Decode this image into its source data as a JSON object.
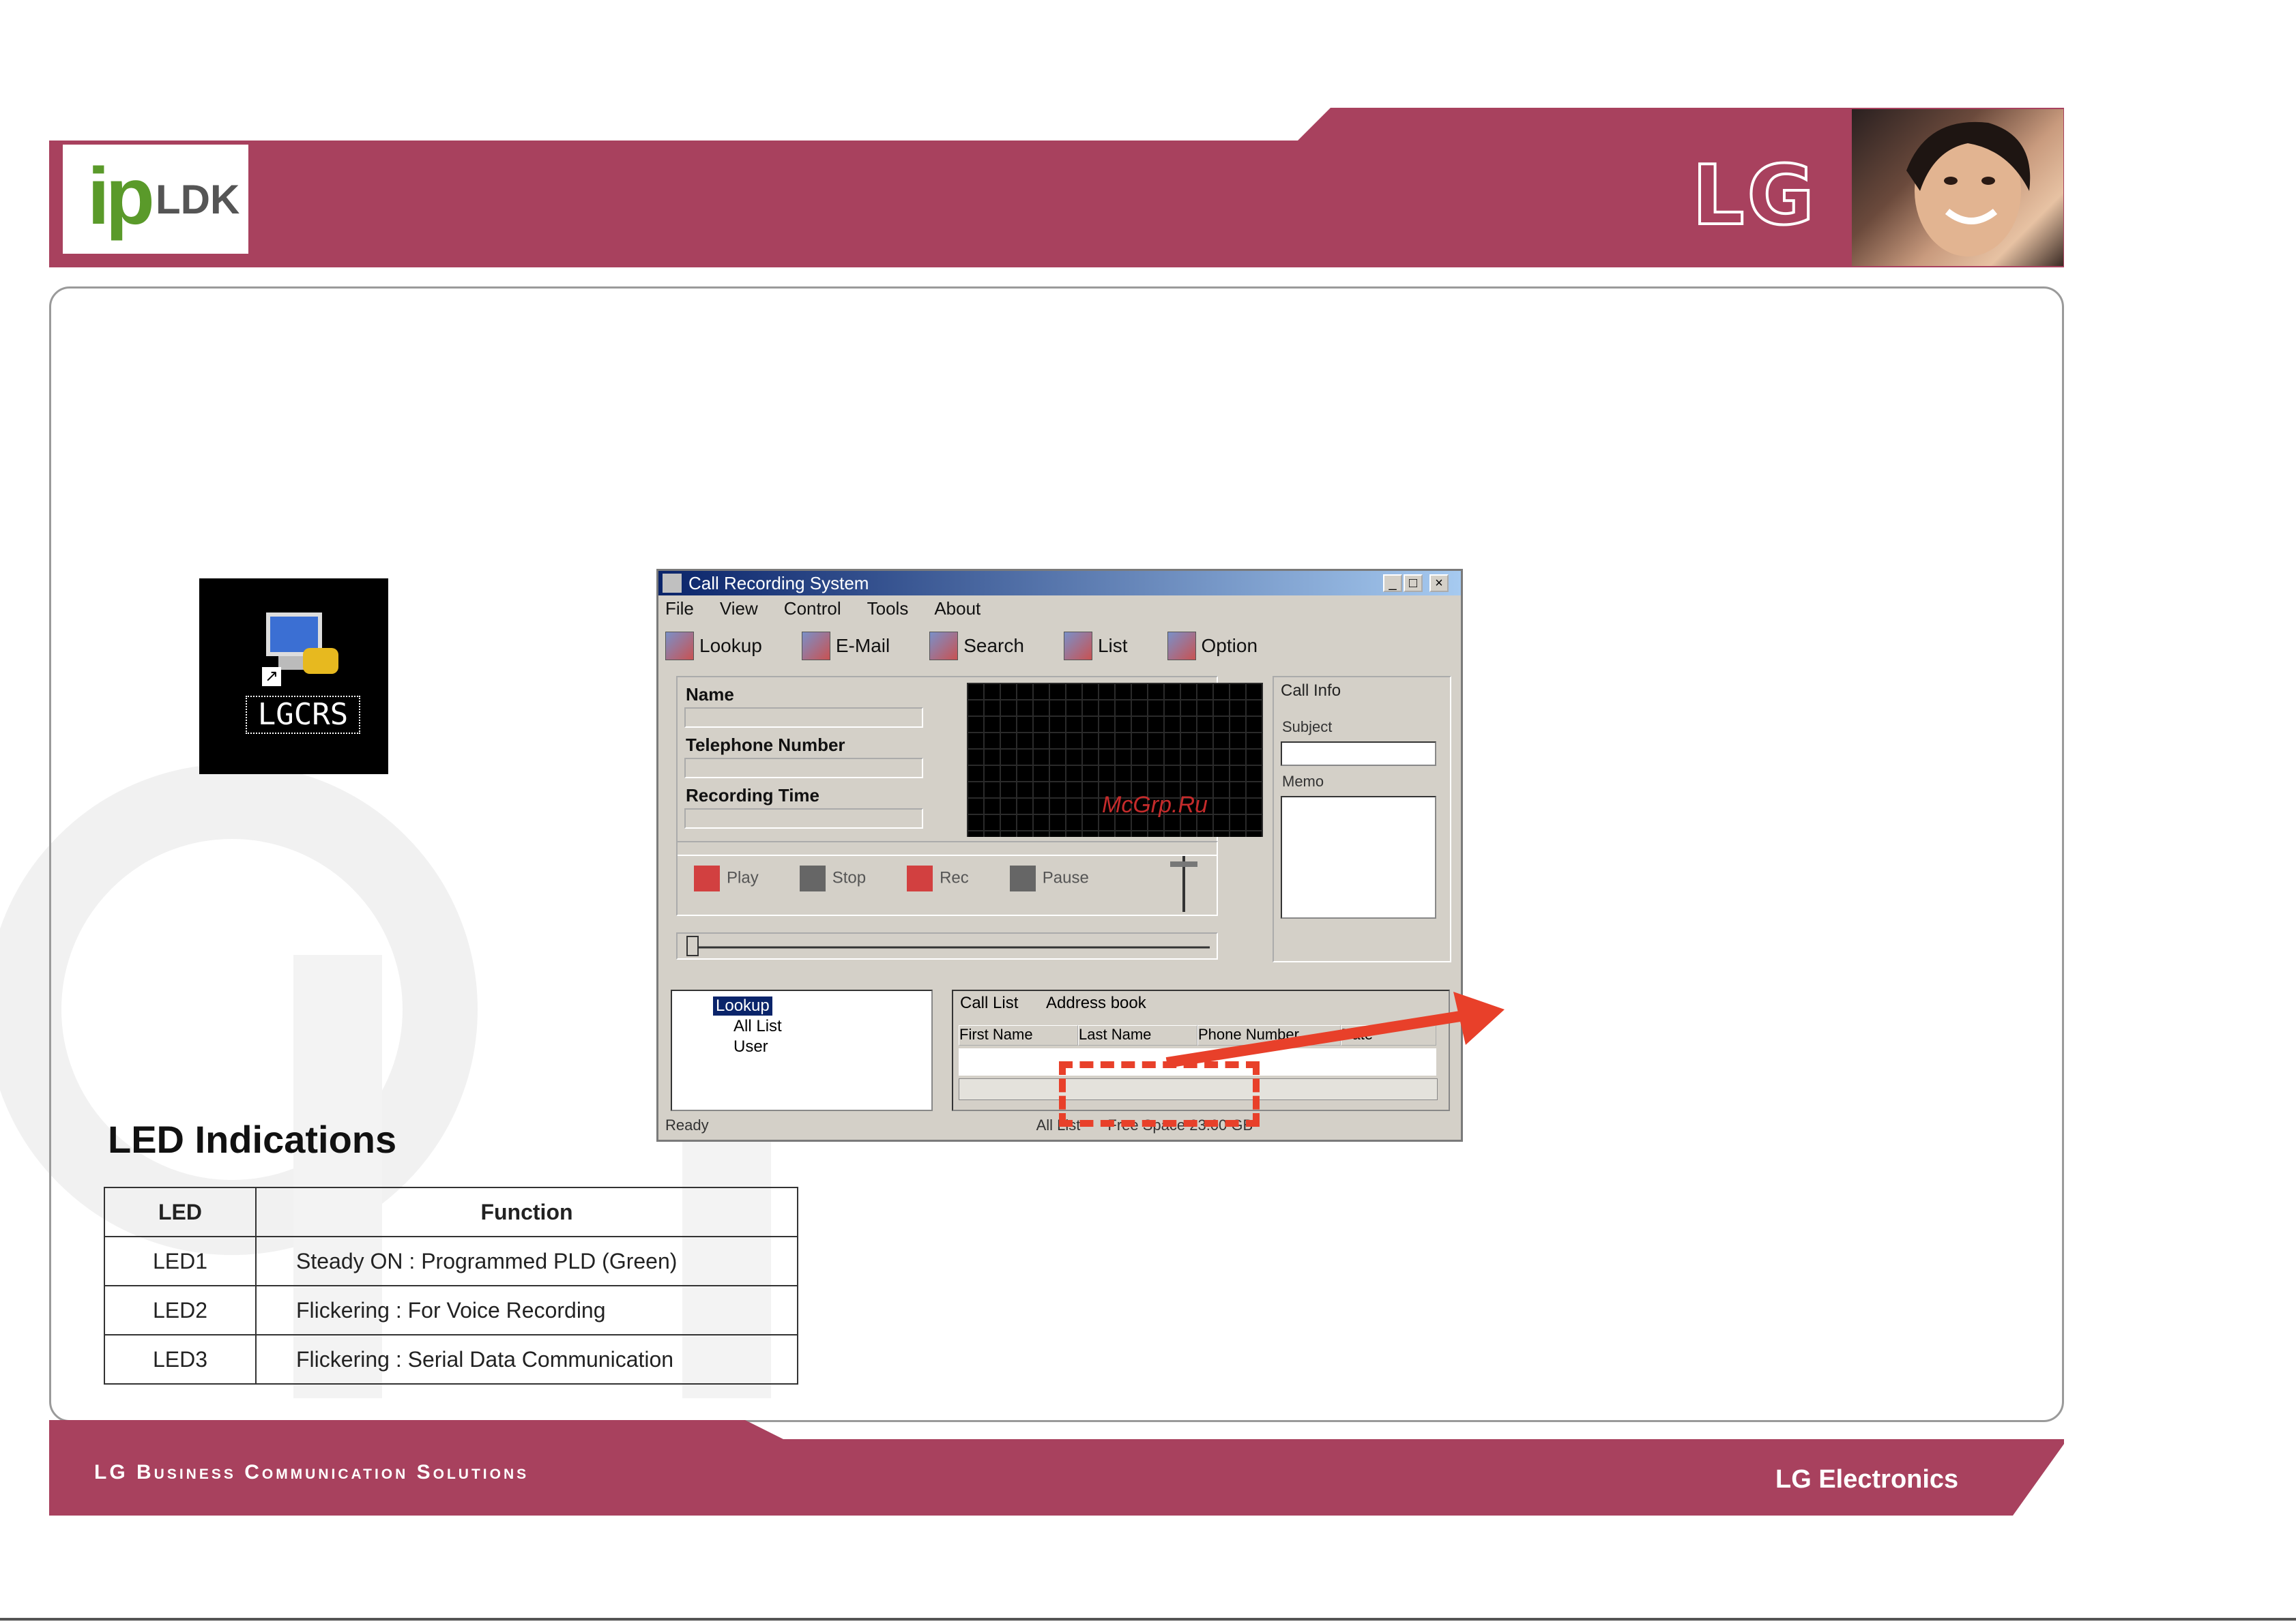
{
  "header": {
    "logo_ip": "ip",
    "logo_ldk": "LDK",
    "brand_mark": "LG"
  },
  "desktop_icon": {
    "label": "LGCRS"
  },
  "app_window": {
    "title": "Call Recording System",
    "menu": [
      "File",
      "View",
      "Control",
      "Tools",
      "About"
    ],
    "toolbar": [
      "Lookup",
      "E-Mail",
      "Search",
      "List",
      "Option"
    ],
    "info_labels": {
      "name": "Name",
      "telephone": "Telephone Number",
      "recording_time": "Recording Time"
    },
    "scope_mark": "McGrp.Ru",
    "controls": [
      "Play",
      "Stop",
      "Rec",
      "Pause"
    ],
    "right_panel": {
      "tab": "Call Info",
      "subject_label": "Subject",
      "memo_label": "Memo"
    },
    "tree": [
      "Lookup",
      "All List",
      "User"
    ],
    "list_tabs": [
      "Call List",
      "Address book"
    ],
    "list_columns": [
      "First Name",
      "Last Name",
      "Phone Number",
      "Date"
    ],
    "status": [
      "Ready",
      "All List",
      "Free Space 23.00 GB"
    ]
  },
  "led": {
    "title": "LED Indications",
    "headers": [
      "LED",
      "Function"
    ],
    "rows": [
      {
        "led": "LED1",
        "function": "Steady ON  :  Programmed PLD (Green)"
      },
      {
        "led": "LED2",
        "function": "Flickering   :  For Voice Recording"
      },
      {
        "led": "LED3",
        "function": "Flickering  : Serial Data Communication"
      }
    ]
  },
  "footer": {
    "left": "LG Business Communication Solutions",
    "right": "LG Electronics"
  },
  "colors": {
    "brand_band": "#a8415e",
    "annotation_red": "#e8402a"
  }
}
